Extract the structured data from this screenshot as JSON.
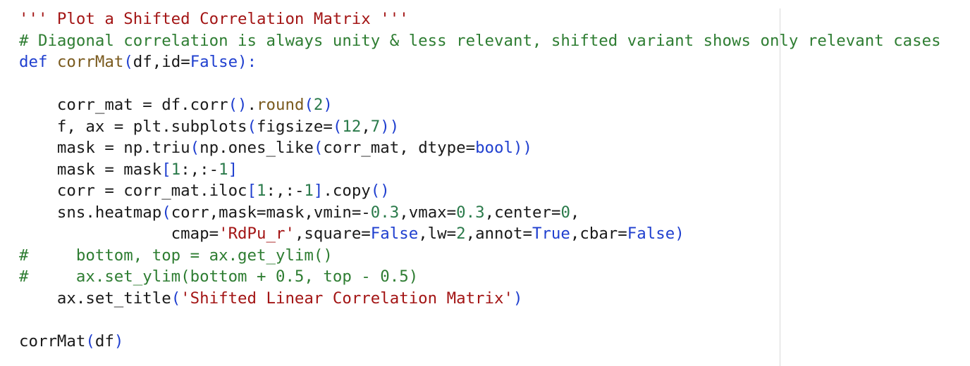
{
  "colors": {
    "string": "#a31515",
    "comment": "#2e7d32",
    "keyword": "#1f3fcf",
    "function": "#7a5a1e",
    "number": "#2a7a4a",
    "plain": "#1a1a1a",
    "background": "#ffffff",
    "ruler": "#d9d9d9"
  },
  "code_lines": [
    [
      {
        "t": "''' Plot a Shifted Correlation Matrix '''",
        "c": "string"
      }
    ],
    [
      {
        "t": "# Diagonal correlation is always unity & less relevant, shifted variant shows only relevant cases",
        "c": "comment"
      }
    ],
    [
      {
        "t": "def",
        "c": "keyword"
      },
      {
        "t": " ",
        "c": "plain"
      },
      {
        "t": "corrMat",
        "c": "func"
      },
      {
        "t": "(",
        "c": "bracket"
      },
      {
        "t": "df,id=",
        "c": "plain"
      },
      {
        "t": "False",
        "c": "keyword"
      },
      {
        "t": "):",
        "c": "bracket"
      }
    ],
    [
      {
        "t": "",
        "c": "plain"
      }
    ],
    [
      {
        "t": "    corr_mat = df.corr",
        "c": "plain"
      },
      {
        "t": "()",
        "c": "bracket"
      },
      {
        "t": ".",
        "c": "plain"
      },
      {
        "t": "round",
        "c": "func"
      },
      {
        "t": "(",
        "c": "bracket"
      },
      {
        "t": "2",
        "c": "number"
      },
      {
        "t": ")",
        "c": "bracket"
      }
    ],
    [
      {
        "t": "    f, ax = plt.subplots",
        "c": "plain"
      },
      {
        "t": "(",
        "c": "bracket"
      },
      {
        "t": "figsize=",
        "c": "plain"
      },
      {
        "t": "(",
        "c": "bracket"
      },
      {
        "t": "12",
        "c": "number"
      },
      {
        "t": ",",
        "c": "plain"
      },
      {
        "t": "7",
        "c": "number"
      },
      {
        "t": "))",
        "c": "bracket"
      }
    ],
    [
      {
        "t": "    mask = np.triu",
        "c": "plain"
      },
      {
        "t": "(",
        "c": "bracket"
      },
      {
        "t": "np.ones_like",
        "c": "plain"
      },
      {
        "t": "(",
        "c": "bracket"
      },
      {
        "t": "corr_mat, dtype=",
        "c": "plain"
      },
      {
        "t": "bool",
        "c": "keyword"
      },
      {
        "t": "))",
        "c": "bracket"
      }
    ],
    [
      {
        "t": "    mask = mask",
        "c": "plain"
      },
      {
        "t": "[",
        "c": "bracket"
      },
      {
        "t": "1",
        "c": "number"
      },
      {
        "t": ":,:-",
        "c": "plain"
      },
      {
        "t": "1",
        "c": "number"
      },
      {
        "t": "]",
        "c": "bracket"
      }
    ],
    [
      {
        "t": "    corr = corr_mat.iloc",
        "c": "plain"
      },
      {
        "t": "[",
        "c": "bracket"
      },
      {
        "t": "1",
        "c": "number"
      },
      {
        "t": ":,:-",
        "c": "plain"
      },
      {
        "t": "1",
        "c": "number"
      },
      {
        "t": "]",
        "c": "bracket"
      },
      {
        "t": ".copy",
        "c": "plain"
      },
      {
        "t": "()",
        "c": "bracket"
      }
    ],
    [
      {
        "t": "    sns.heatmap",
        "c": "plain"
      },
      {
        "t": "(",
        "c": "bracket"
      },
      {
        "t": "corr,mask=mask,vmin=-",
        "c": "plain"
      },
      {
        "t": "0.3",
        "c": "number"
      },
      {
        "t": ",vmax=",
        "c": "plain"
      },
      {
        "t": "0.3",
        "c": "number"
      },
      {
        "t": ",center=",
        "c": "plain"
      },
      {
        "t": "0",
        "c": "number"
      },
      {
        "t": ",",
        "c": "plain"
      }
    ],
    [
      {
        "t": "                cmap=",
        "c": "plain"
      },
      {
        "t": "'RdPu_r'",
        "c": "string"
      },
      {
        "t": ",square=",
        "c": "plain"
      },
      {
        "t": "False",
        "c": "keyword"
      },
      {
        "t": ",lw=",
        "c": "plain"
      },
      {
        "t": "2",
        "c": "number"
      },
      {
        "t": ",annot=",
        "c": "plain"
      },
      {
        "t": "True",
        "c": "keyword"
      },
      {
        "t": ",cbar=",
        "c": "plain"
      },
      {
        "t": "False",
        "c": "keyword"
      },
      {
        "t": ")",
        "c": "bracket"
      }
    ],
    [
      {
        "t": "#     bottom, top = ax.get_ylim()",
        "c": "comment"
      }
    ],
    [
      {
        "t": "#     ax.set_ylim(bottom + 0.5, top - 0.5)",
        "c": "comment"
      }
    ],
    [
      {
        "t": "    ax.set_title",
        "c": "plain"
      },
      {
        "t": "(",
        "c": "bracket"
      },
      {
        "t": "'Shifted Linear Correlation Matrix'",
        "c": "string"
      },
      {
        "t": ")",
        "c": "bracket"
      }
    ],
    [
      {
        "t": "",
        "c": "plain"
      }
    ],
    [
      {
        "t": "corrMat",
        "c": "plain"
      },
      {
        "t": "(",
        "c": "bracket"
      },
      {
        "t": "df",
        "c": "plain"
      },
      {
        "t": ")",
        "c": "bracket"
      }
    ]
  ]
}
